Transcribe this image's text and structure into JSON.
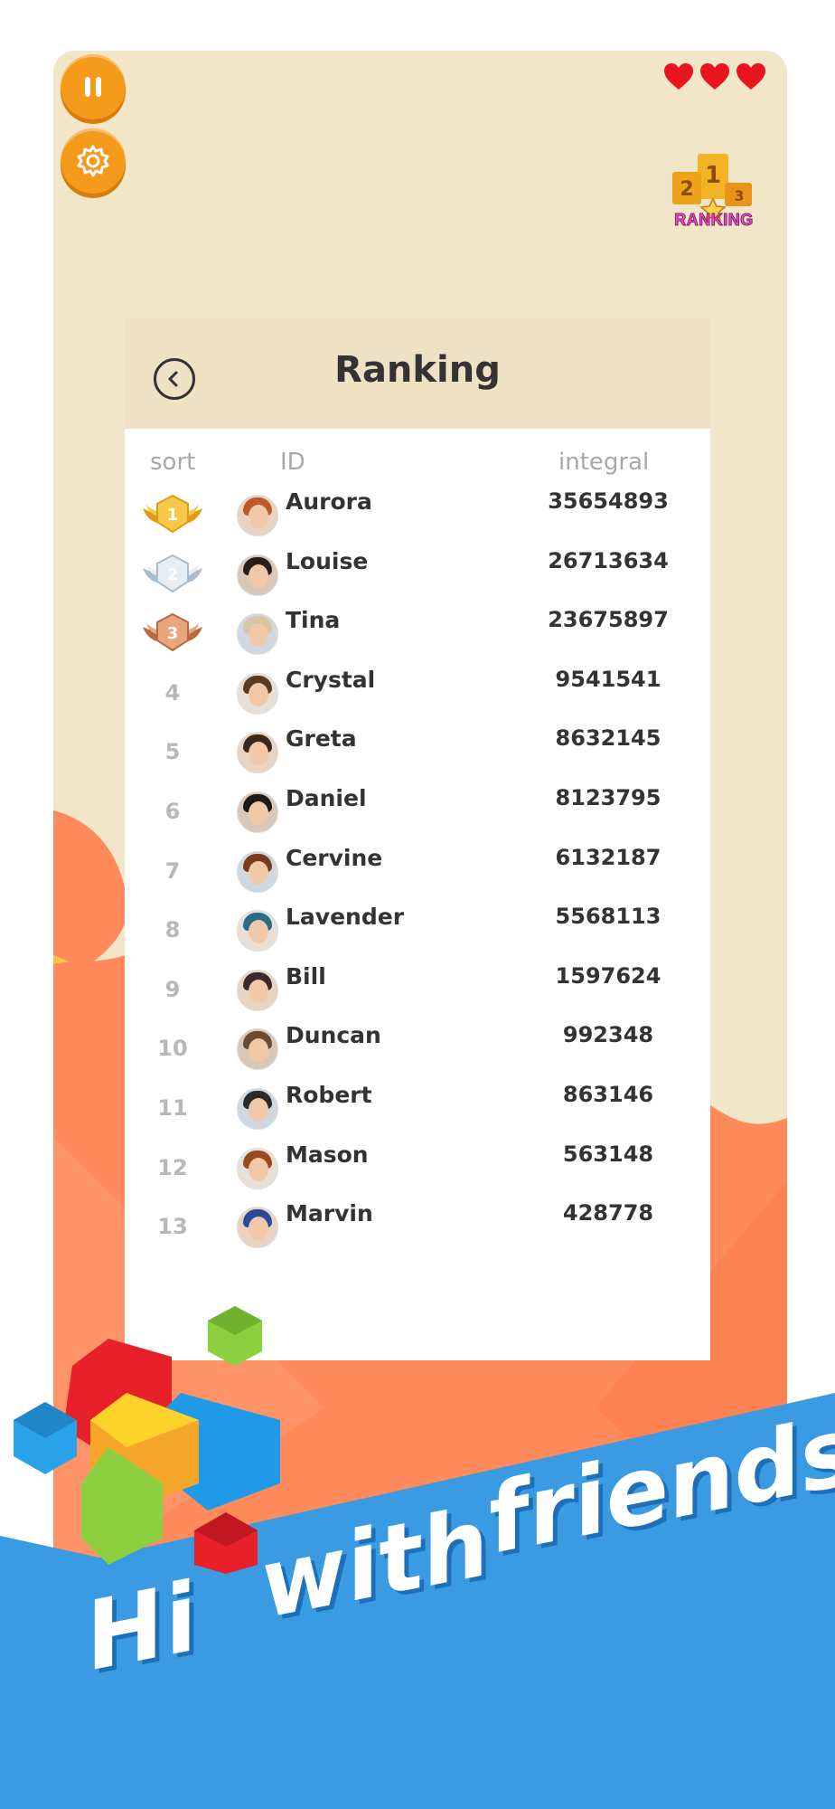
{
  "colors": {
    "accent": "#f59a1b",
    "card_bg": "#f1e6c8",
    "hero_blue": "#3a9be2",
    "coral": "#ff8a5c",
    "heart": "#e8141e"
  },
  "hud": {
    "pause_icon": "pause-icon",
    "settings_icon": "gear-icon",
    "hearts_count": 3,
    "ranking_badge": "RANKING"
  },
  "panel": {
    "title": "Ranking",
    "back_icon": "chevron-left-icon",
    "columns": {
      "sort": "sort",
      "id": "ID",
      "integral": "integral"
    },
    "rows": [
      {
        "rank": "1",
        "medal": "gold",
        "name": "Aurora",
        "score": "35654893"
      },
      {
        "rank": "2",
        "medal": "silver",
        "name": "Louise",
        "score": "26713634"
      },
      {
        "rank": "3",
        "medal": "bronze",
        "name": "Tina",
        "score": "23675897"
      },
      {
        "rank": "4",
        "name": "Crystal",
        "score": "9541541"
      },
      {
        "rank": "5",
        "name": "Greta",
        "score": "8632145"
      },
      {
        "rank": "6",
        "name": "Daniel",
        "score": "8123795"
      },
      {
        "rank": "7",
        "name": "Cervine",
        "score": "6132187"
      },
      {
        "rank": "8",
        "name": "Lavender",
        "score": "5568113"
      },
      {
        "rank": "9",
        "name": "Bill",
        "score": "1597624"
      },
      {
        "rank": "10",
        "name": "Duncan",
        "score": "992348"
      },
      {
        "rank": "11",
        "name": "Robert",
        "score": "863146"
      },
      {
        "rank": "12",
        "name": "Mason",
        "score": "563148"
      },
      {
        "rank": "13",
        "name": "Marvin",
        "score": "428778"
      }
    ]
  },
  "tagline": {
    "word1": "Hi",
    "word2": "with",
    "word3": "friends"
  }
}
